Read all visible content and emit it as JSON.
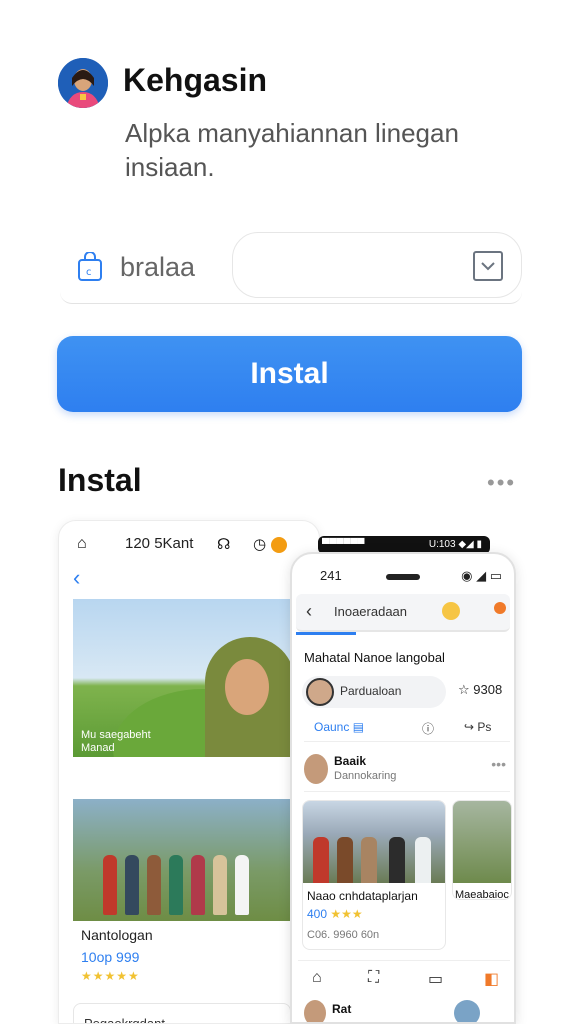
{
  "app": {
    "title": "Kehgasin",
    "description": "Alpka manyahiannan linegan insiaan."
  },
  "field": {
    "label": "bralaa"
  },
  "install_button": "Instal",
  "section": {
    "title": "Instal",
    "more": "•••"
  },
  "shot1": {
    "clock": "120 5Kant",
    "photo_caption_1": "Mu saegabeht",
    "photo_caption_2": "Manad",
    "card_title": "Nantologan",
    "price": "10op 999",
    "stars": "★★★★★",
    "bottom_text": "Pegaokrgdant"
  },
  "shot2": {
    "bar_left": "▀▀▀▀▀▀",
    "bar_right": "U:103 ◆◢ ▮",
    "time": "241",
    "status_right": "◉ ◢ ▭",
    "query": "Inoaeradaan",
    "title": "Mahatal Nanoe langobal",
    "search_text": "Pardualoan",
    "rating": "☆ 9308",
    "action_1": "Oaunc ▤",
    "action_2": "ⓘ",
    "action_3": "↪ Ps",
    "user_name": "Baaik",
    "user_sub": "Dannokaring",
    "card_title": "Naao cnhdataplarjan",
    "card_price": "400",
    "card_stars": "★★★",
    "card_date": "C06. 9960 60n",
    "card2_title": "Maeabaioc",
    "last_name": "Rat"
  },
  "colors": {
    "accent": "#2e7ff0",
    "star": "#f1c232"
  }
}
